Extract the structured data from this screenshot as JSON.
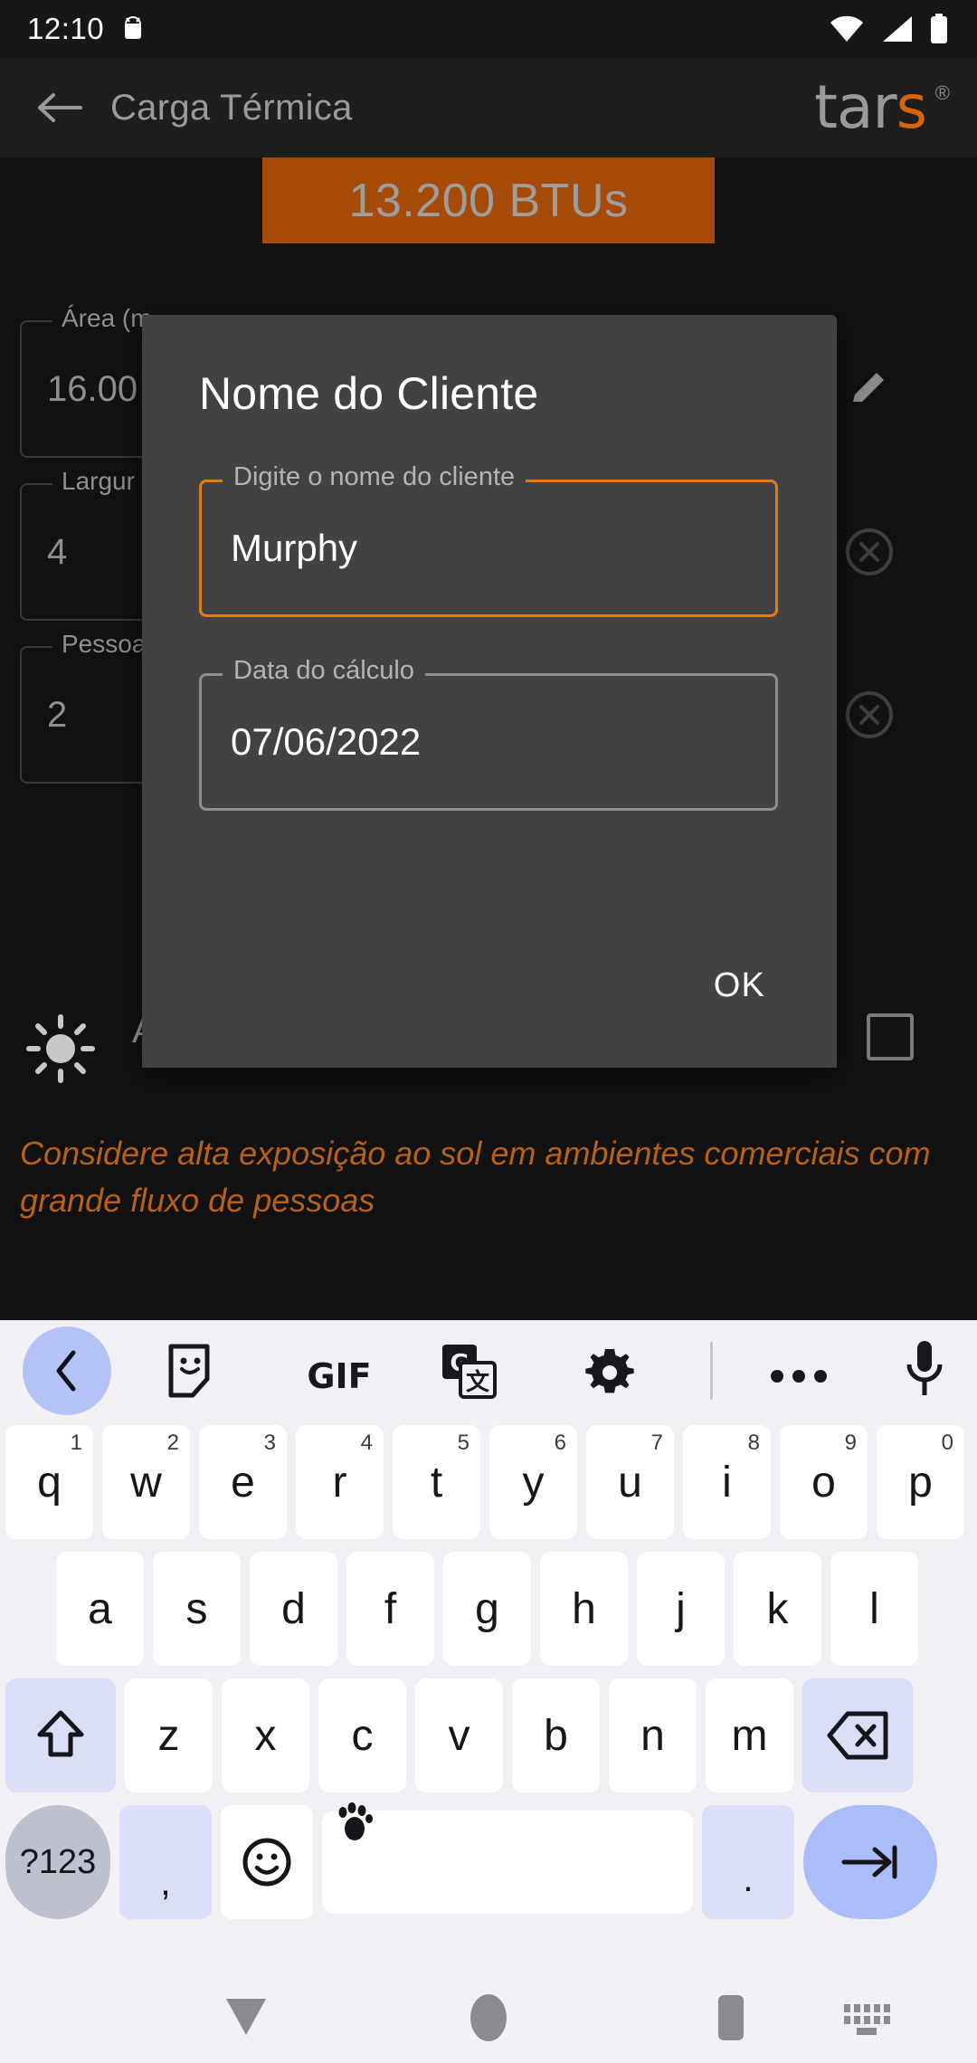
{
  "status_bar": {
    "time": "12:10",
    "icons": [
      "android-debug-icon",
      "wifi-icon",
      "cellular-signal-icon",
      "battery-icon"
    ]
  },
  "app": {
    "toolbar": {
      "back_icon": "back-arrow-icon",
      "title": "Carga Térmica",
      "brand": "tars",
      "brand_s": "s",
      "registered_mark": "®"
    },
    "result_banner": {
      "value": "13.200 BTUs"
    },
    "fields": [
      {
        "label": "Área (m",
        "value": "16.00",
        "action_icon": "pencil-edit-icon"
      },
      {
        "label": "Largur",
        "value": "4",
        "action_icon": "clear-circle-icon"
      },
      {
        "label": "Pessoa",
        "value": "2",
        "action_icon": "clear-circle-icon"
      }
    ],
    "sun_option": {
      "icon": "sun-icon",
      "label": "Ambientes com alta exposição ao sol",
      "checked": false
    },
    "hint": "Considere alta exposição ao sol em ambientes comerciais com grande fluxo de pessoas"
  },
  "dialog": {
    "title": "Nome do Cliente",
    "name_field": {
      "label": "Digite o nome do cliente",
      "value": "Murphy",
      "placeholder": "Digite o nome do cliente",
      "focused": true
    },
    "date_field": {
      "label": "Data do cálculo",
      "value": "07/06/2022",
      "placeholder": "Data do cálculo",
      "focused": false
    },
    "ok_label": "OK"
  },
  "keyboard": {
    "toolbar": [
      "chevron-left-icon",
      "sticker-icon",
      "gif-icon",
      "google-translate-icon",
      "gear-icon",
      "more-horizontal-icon",
      "microphone-icon"
    ],
    "row1": [
      {
        "key": "q",
        "num": "1"
      },
      {
        "key": "w",
        "num": "2"
      },
      {
        "key": "e",
        "num": "3"
      },
      {
        "key": "r",
        "num": "4"
      },
      {
        "key": "t",
        "num": "5"
      },
      {
        "key": "y",
        "num": "6"
      },
      {
        "key": "u",
        "num": "7"
      },
      {
        "key": "i",
        "num": "8"
      },
      {
        "key": "o",
        "num": "9"
      },
      {
        "key": "p",
        "num": "0"
      }
    ],
    "row2": [
      "a",
      "s",
      "d",
      "f",
      "g",
      "h",
      "j",
      "k",
      "l"
    ],
    "row3": [
      "z",
      "x",
      "c",
      "v",
      "b",
      "n",
      "m"
    ],
    "shift_icon": "shift-up-arrow-icon",
    "backspace_icon": "backspace-icon",
    "row4": {
      "symbols_label": "?123",
      "comma_label": ",",
      "emoji_icon": "emoji-smiley-icon",
      "space_label": "",
      "period_label": ".",
      "enter_icon": "enter-next-arrow-icon"
    }
  },
  "nav_bar": {
    "items": [
      "back-triangle-icon",
      "home-circle-icon",
      "recents-square-icon",
      "keyboard-switch-icon"
    ]
  },
  "colors": {
    "accent_orange": "#e07b1a",
    "banner_orange": "#a64a07",
    "hint_orange": "#b5611b",
    "dialog_bg": "#424242",
    "app_bg": "#121212",
    "keyboard_bg": "#f1f1f5",
    "key_mod": "#dadff7",
    "key_enter": "#aabcf9"
  }
}
